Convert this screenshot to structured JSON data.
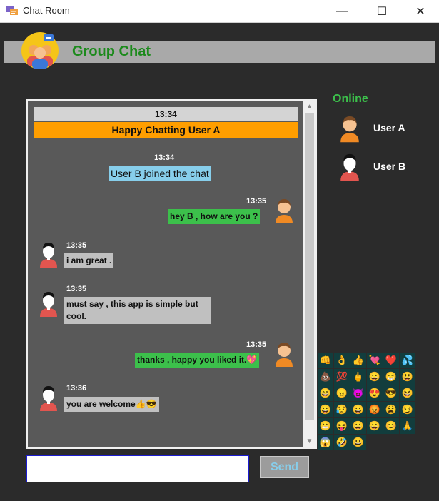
{
  "window": {
    "title": "Chat Room",
    "min": "—",
    "max": "☐",
    "close": "✕"
  },
  "header": {
    "title": "Group Chat"
  },
  "chat": {
    "welcome_time": "13:34",
    "welcome_text": "Happy Chatting User A",
    "join_time": "13:34",
    "join_text": "User B joined the chat",
    "messages": [
      {
        "side": "right",
        "time": "13:35",
        "text": "hey B , how are you ?"
      },
      {
        "side": "left",
        "time": "13:35",
        "text": "i am great ."
      },
      {
        "side": "left",
        "time": "13:35",
        "text": "must say , this app is simple but cool."
      },
      {
        "side": "right",
        "time": "13:35",
        "text": "thanks , happy you liked it.💖"
      },
      {
        "side": "left",
        "time": "13:36",
        "text": "you are welcome👍😎"
      }
    ]
  },
  "online": {
    "title": "Online",
    "users": [
      "User A",
      "User B"
    ]
  },
  "emojis": [
    "👊",
    "👌",
    "👍",
    "💘",
    "❤️",
    "💦",
    "💩",
    "💯",
    "🖕",
    "😀",
    "😁",
    "😃",
    "😄",
    "😠",
    "👿",
    "😍",
    "😎",
    "😆",
    "😀",
    "😥",
    "😀",
    "😡",
    "😩",
    "😏",
    "😬",
    "😝",
    "😀",
    "😀",
    "😊",
    "🙏",
    "😱",
    "🤣",
    "😀"
  ],
  "input": {
    "value": ""
  },
  "send": {
    "label": "Send"
  },
  "colors": {
    "accent_green": "#3cc04b",
    "banner_orange": "#ff9e00",
    "join_blue": "#87ceeb",
    "bg": "#2b2b2b"
  }
}
